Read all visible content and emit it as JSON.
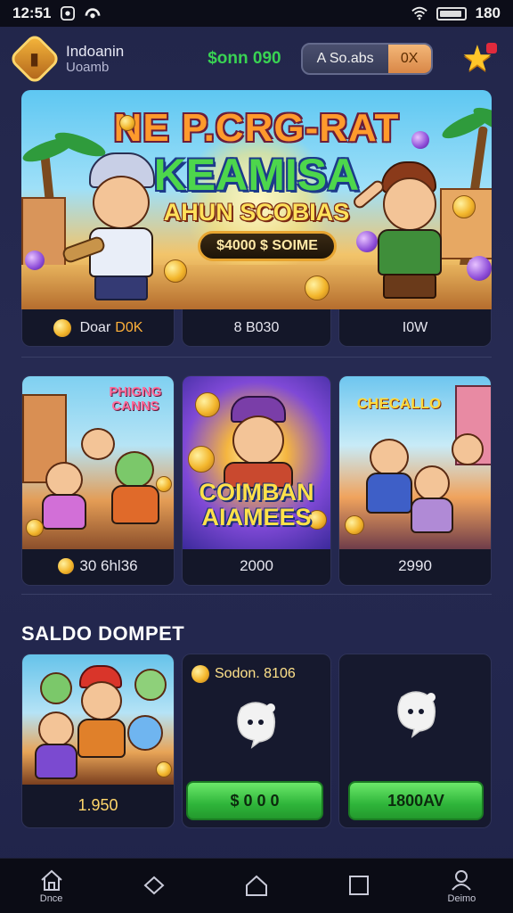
{
  "status_bar": {
    "time": "12:51",
    "battery_text": "180",
    "icons": [
      "notification-icon",
      "app-icon",
      "wifi-icon",
      "battery-icon"
    ]
  },
  "header": {
    "user_name": "Indoanin",
    "user_subtitle": "Uoamb",
    "balance_text": "$onn 090",
    "pill_label": "A So.abs",
    "pill_value": "0X",
    "accent_color": "#39d353"
  },
  "hero": {
    "title_line_1": "NE P.CRG-RAT",
    "title_line_2": "KEAMISA",
    "title_line_3": "AHUN SCOBIAS",
    "chip_text": "$4000 $ SOIME",
    "captions": [
      {
        "text": "Doar",
        "accent": "D0K"
      },
      {
        "text": "8 B030",
        "accent": ""
      },
      {
        "text": "I0W",
        "accent": ""
      }
    ]
  },
  "grid": {
    "cards": [
      {
        "art_title": "PHIGNG CANNS",
        "caption": "30 6hl36"
      },
      {
        "art_title": "COIMBAN AIAMEES",
        "caption": "2000"
      },
      {
        "art_title": "CHECALLO",
        "caption": "2990"
      }
    ]
  },
  "section": {
    "title": "SALDO DOMPET"
  },
  "wallet": {
    "card1_caption": "1.950",
    "card2_header": "Sodon. 8106",
    "card2_button": "$ 0 0 0",
    "card3_button": "1800AV"
  },
  "bottom_nav": {
    "items": [
      {
        "label": "Dnce",
        "icon": "home-icon"
      },
      {
        "label": "",
        "icon": "back-icon"
      },
      {
        "label": "",
        "icon": "house-icon"
      },
      {
        "label": "",
        "icon": "square-icon"
      },
      {
        "label": "Deimo",
        "icon": "profile-icon"
      }
    ]
  }
}
